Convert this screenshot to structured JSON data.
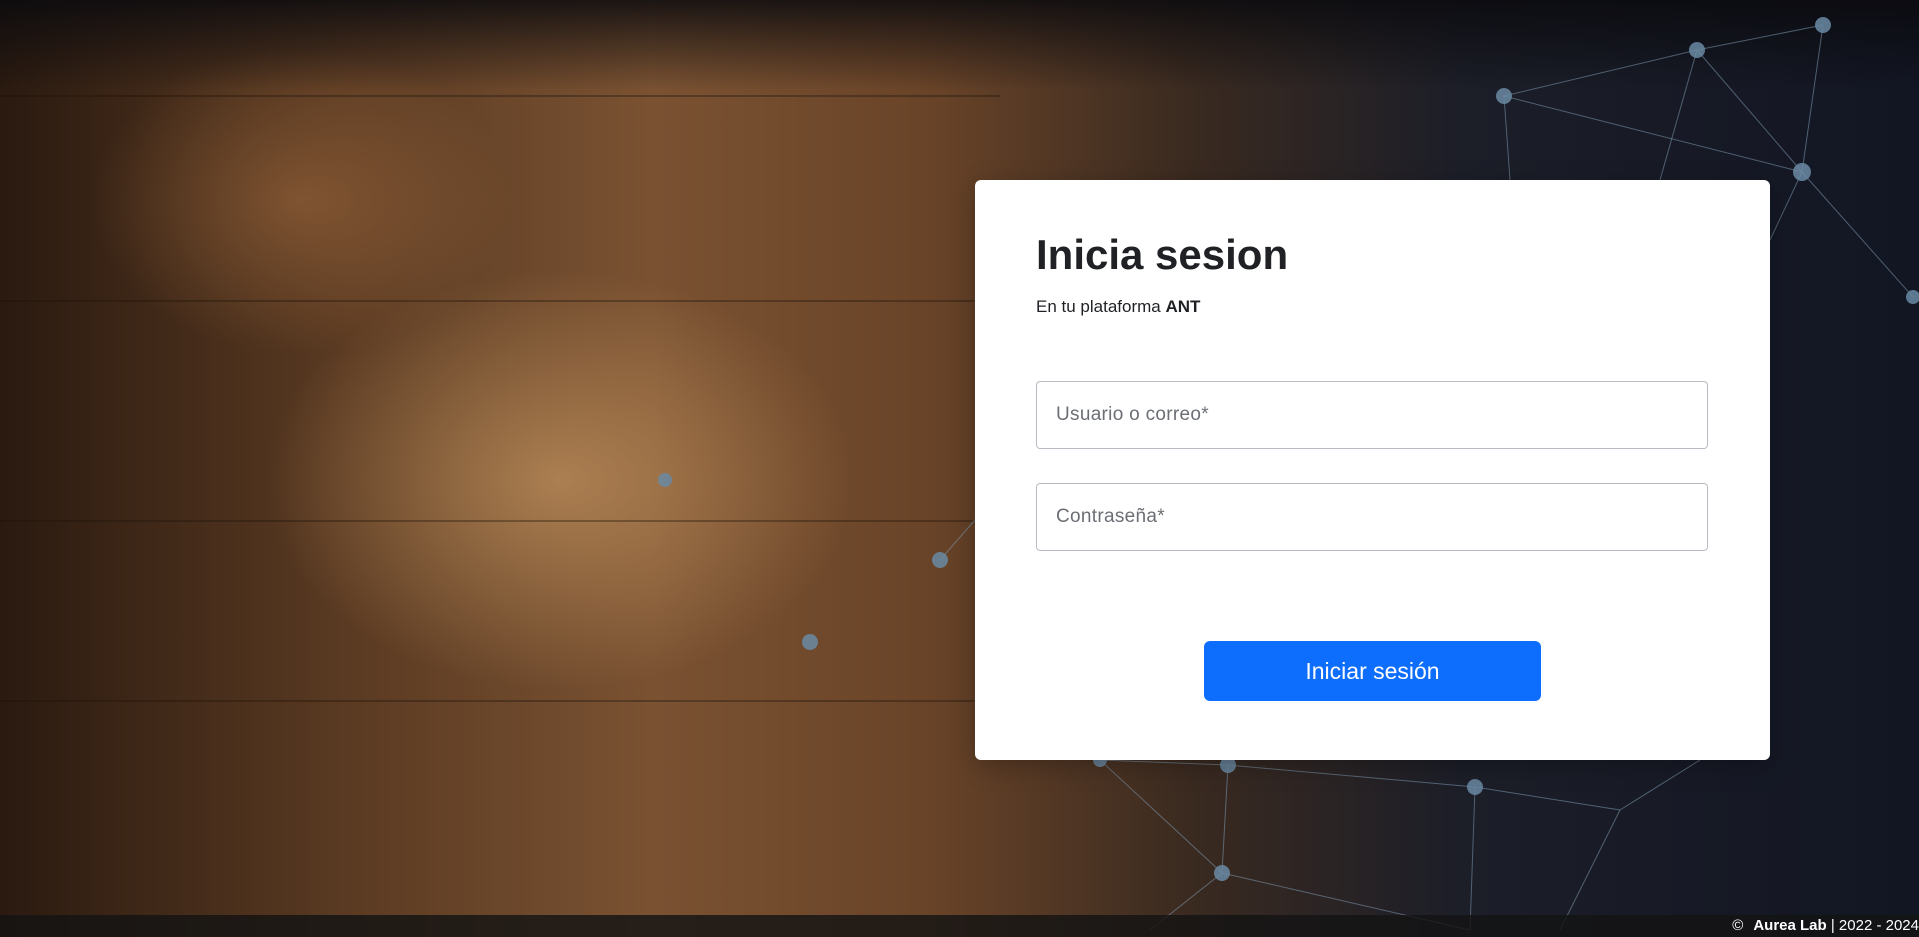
{
  "login": {
    "title": "Inicia sesion",
    "subtitle_prefix": "En tu plataforma ",
    "subtitle_brand": "ANT",
    "username_placeholder": "Usuario o correo*",
    "password_placeholder": "Contraseña*",
    "submit_label": "Iniciar sesión",
    "submit_color": "#0d6efd"
  },
  "footer": {
    "copyright_symbol": "©",
    "company": "Aurea Lab",
    "years": " | 2022 - 2024"
  },
  "background": {
    "description_icon": "team-hands-photo",
    "network_color": "#6a8aa3"
  }
}
